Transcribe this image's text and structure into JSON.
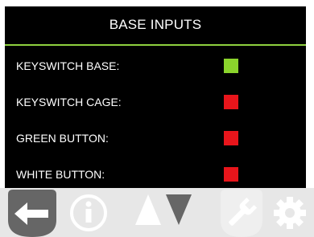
{
  "header": {
    "title": "BASE INPUTS"
  },
  "inputs": [
    {
      "label": "KEYSWITCH BASE:",
      "state": "active",
      "indicator_color": "#8bd42c"
    },
    {
      "label": "KEYSWITCH CAGE:",
      "state": "inactive",
      "indicator_color": "#e8151b"
    },
    {
      "label": "GREEN BUTTON:",
      "state": "inactive",
      "indicator_color": "#e8151b"
    },
    {
      "label": "WHITE BUTTON:",
      "state": "inactive",
      "indicator_color": "#e8151b"
    }
  ],
  "toolbar": {
    "buttons": [
      {
        "icon": "back-arrow-icon",
        "enabled": true
      },
      {
        "icon": "info-icon",
        "enabled": false
      },
      {
        "icon": "up-arrow-icon",
        "enabled": false
      },
      {
        "icon": "down-arrow-icon",
        "enabled": true
      },
      {
        "icon": "wrench-icon",
        "enabled": false
      },
      {
        "icon": "gear-icon",
        "enabled": false
      }
    ]
  },
  "colors": {
    "panel_bg": "#000000",
    "accent_rule": "#8fd13f",
    "text": "#ffffff",
    "toolbar_bg": "#e7e7e7",
    "icon_enabled": "#666666",
    "icon_disabled": "#ffffff"
  }
}
